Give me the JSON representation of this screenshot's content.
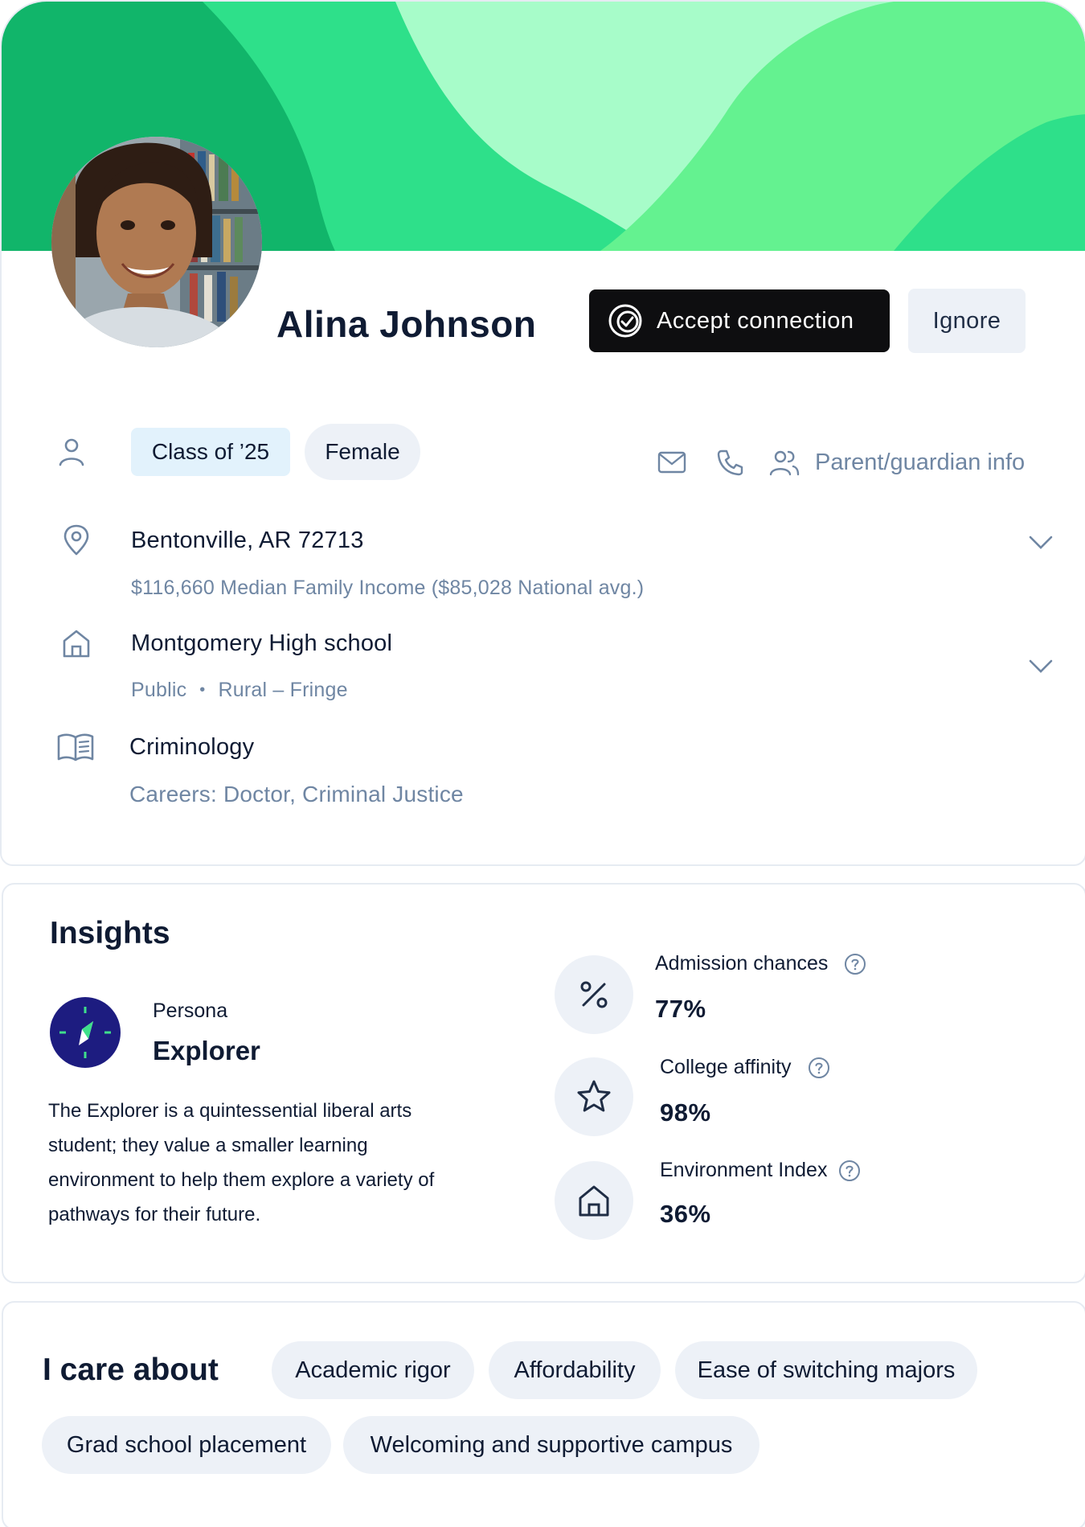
{
  "colors": {
    "banner_dark": "#11b56a",
    "banner_mid": "#2ee08a",
    "banner_light": "#a7fcc9",
    "banner_bright": "#64f290",
    "accent_dark": "#0e0e10",
    "chip_blue": "#e2f2fc",
    "chip_grey": "#edf1f7",
    "muted_text": "#6f86a3",
    "persona_badge": "#1d1c80"
  },
  "profile": {
    "name": "Alina Johnson",
    "avatar_alt": "student-portrait",
    "accept_label": "Accept connection",
    "ignore_label": "Ignore",
    "class_chip": "Class of ’25",
    "gender_chip": "Female",
    "parent_link": "Parent/guardian info",
    "location": "Bentonville, AR 72713",
    "income": "$116,660 Median Family Income ($85,028 National avg.)",
    "school": "Montgomery High school",
    "school_type": "Public",
    "school_locale": "Rural – Fringe",
    "major": "Criminology",
    "careers": "Careers: Doctor, Criminal Justice"
  },
  "insights": {
    "title": "Insights",
    "persona_label": "Persona",
    "persona_name": "Explorer",
    "persona_description": "The Explorer is a quintessential liberal arts student; they value a smaller learning environment to help them explore a variety of pathways for their future.",
    "metrics": [
      {
        "label": "Admission chances",
        "value": "77%",
        "icon": "percent-icon"
      },
      {
        "label": "College affinity",
        "value": "98%",
        "icon": "star-icon"
      },
      {
        "label": "Environment Index",
        "value": "36%",
        "icon": "home-icon"
      }
    ]
  },
  "care": {
    "title": "I care about",
    "tags": [
      "Academic rigor",
      "Affordability",
      "Ease of switching majors",
      "Grad school placement",
      "Welcoming and supportive campus"
    ]
  }
}
